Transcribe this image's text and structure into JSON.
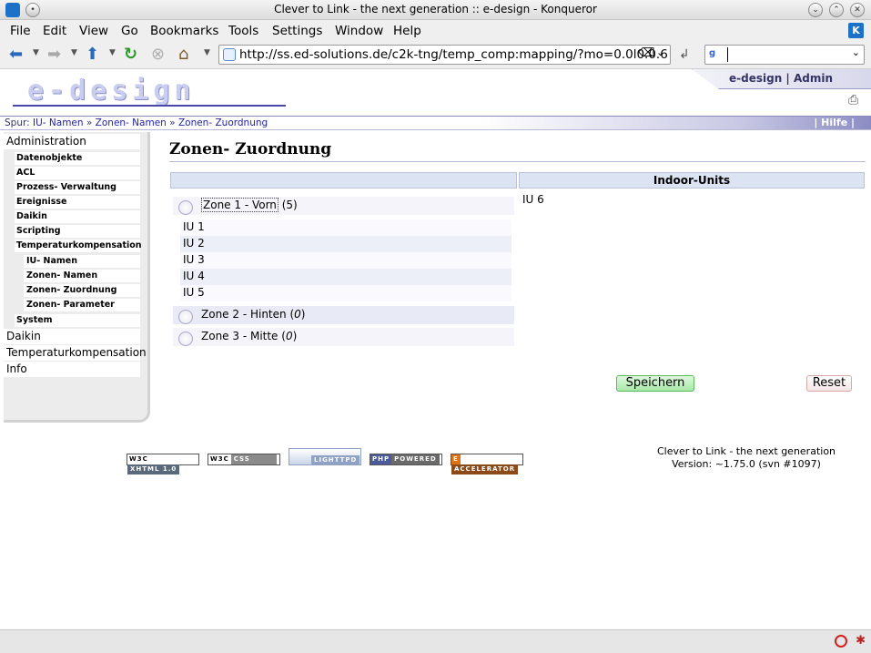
{
  "window": {
    "title": "Clever to Link - the next generation :: e-design - Konqueror"
  },
  "menu": [
    "File",
    "Edit",
    "View",
    "Go",
    "Bookmarks",
    "Tools",
    "Settings",
    "Window",
    "Help"
  ],
  "toolbar": {
    "url": "http://ss.ed-solutions.de/c2k-tng/temp_comp:mapping/?mo=0.0l0.0.6",
    "search_value": ""
  },
  "site": {
    "logo_text": "e-design",
    "tab_text": "e-design | Admin"
  },
  "breadcrumb": {
    "prefix": "Spur:",
    "items": [
      "IU- Namen",
      "Zonen- Namen",
      "Zonen- Zuordnung"
    ],
    "separator": "»",
    "help": "| Hilfe |"
  },
  "sidebar": {
    "items": [
      {
        "label": "Administration",
        "level": 1
      },
      {
        "label": "Datenobjekte",
        "level": 2
      },
      {
        "label": "ACL",
        "level": 2
      },
      {
        "label": "Prozess- Verwaltung",
        "level": 2
      },
      {
        "label": "Ereignisse",
        "level": 2
      },
      {
        "label": "Daikin",
        "level": 2
      },
      {
        "label": "Scripting",
        "level": 2
      },
      {
        "label": "Temperaturkompensation",
        "level": 2
      },
      {
        "label": "IU- Namen",
        "level": 3
      },
      {
        "label": "Zonen- Namen",
        "level": 3
      },
      {
        "label": "Zonen- Zuordnung",
        "level": 3
      },
      {
        "label": "Zonen- Parameter",
        "level": 3
      },
      {
        "label": "System",
        "level": 2
      },
      {
        "label": "Daikin",
        "level": 1
      },
      {
        "label": "Temperaturkompensation",
        "level": 1
      },
      {
        "label": "Info",
        "level": 1
      }
    ]
  },
  "main": {
    "heading": "Zonen- Zuordnung",
    "right_column_header": "Indoor-Units",
    "zones": [
      {
        "label": "Zone 1 - Vorn",
        "count": "5",
        "members": [
          "IU 1",
          "IU 2",
          "IU 3",
          "IU 4",
          "IU 5"
        ]
      },
      {
        "label": "Zone 2 - Hinten",
        "count": "0",
        "members": []
      },
      {
        "label": "Zone 3 - Mitte",
        "count": "0",
        "members": []
      }
    ],
    "unassigned": [
      "IU 6"
    ],
    "save_label": "Speichern",
    "reset_label": "Reset"
  },
  "footer": {
    "badges": [
      {
        "left": "W3C",
        "right": "XHTML 1.0",
        "color": "#5a6a7a"
      },
      {
        "left": "W3C",
        "right": "CSS",
        "color": "#8a8a8a"
      },
      {
        "left": "",
        "right": "LIGHTTPD",
        "color": "#8fa2c4"
      },
      {
        "left": "PHP",
        "right": "POWERED",
        "color": "#6a6a6a"
      },
      {
        "left": "E",
        "right": "ACCELERATOR",
        "color": "#c25a1a"
      }
    ],
    "line1": "Clever to Link - the next generation",
    "line2": "Version: ~1.75.0 (svn #1097)"
  }
}
